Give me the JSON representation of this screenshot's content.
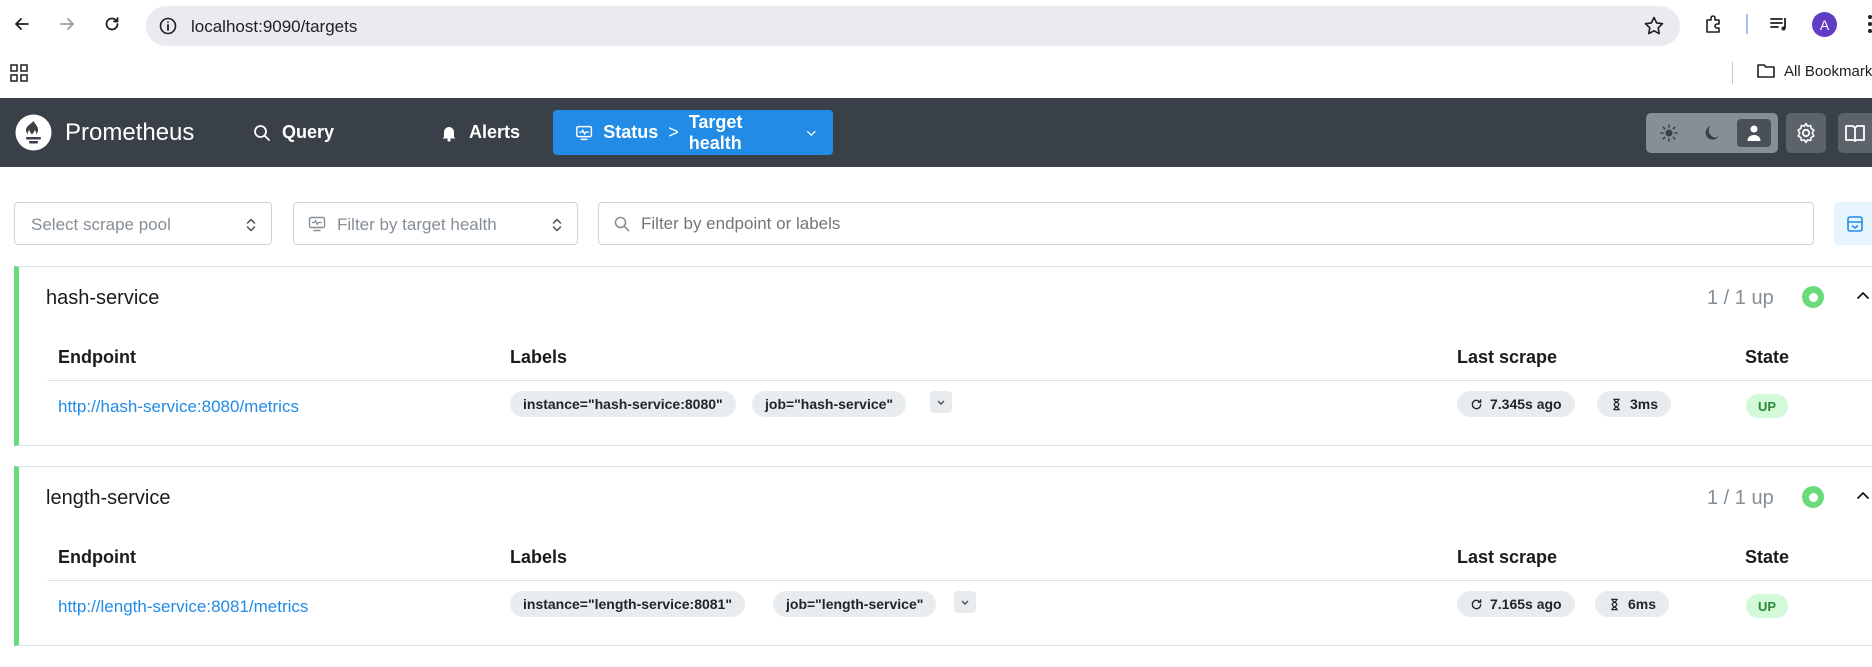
{
  "browser": {
    "url": "localhost:9090/targets",
    "profile_initial": "A",
    "bookmarks_label": "All Bookmarks"
  },
  "app": {
    "brand": "Prometheus",
    "nav": {
      "query": "Query",
      "alerts": "Alerts",
      "status_section": "Status",
      "status_separator": ">",
      "status_page": "Target health"
    }
  },
  "filters": {
    "scrape_pool_placeholder": "Select scrape pool",
    "health_placeholder": "Filter by target health",
    "search_placeholder": "Filter by endpoint or labels"
  },
  "table_headers": {
    "endpoint": "Endpoint",
    "labels": "Labels",
    "last_scrape": "Last scrape",
    "state": "State"
  },
  "pools": [
    {
      "name": "hash-service",
      "count": "1 / 1 up",
      "health_color": "#69db7c",
      "targets": [
        {
          "endpoint": "http://hash-service:8080/metrics",
          "labels": [
            "instance=\"hash-service:8080\"",
            "job=\"hash-service\""
          ],
          "last_scrape": "7.345s ago",
          "duration": "3ms",
          "state": "UP"
        }
      ]
    },
    {
      "name": "length-service",
      "count": "1 / 1 up",
      "health_color": "#69db7c",
      "targets": [
        {
          "endpoint": "http://length-service:8081/metrics",
          "labels": [
            "instance=\"length-service:8081\"",
            "job=\"length-service\""
          ],
          "last_scrape": "7.165s ago",
          "duration": "6ms",
          "state": "UP"
        }
      ]
    }
  ],
  "colors": {
    "header_bg": "#3a4048",
    "accent": "#228be6",
    "up_green": "#69db7c"
  }
}
